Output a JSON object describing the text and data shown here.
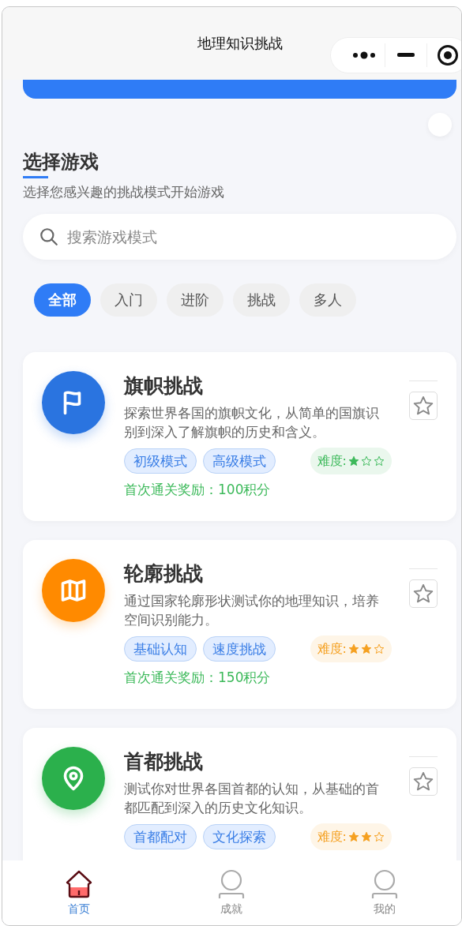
{
  "header": {
    "title": "地理知识挑战"
  },
  "section": {
    "title": "选择游戏",
    "subtitle": "选择您感兴趣的挑战模式开始游戏"
  },
  "search": {
    "placeholder": "搜索游戏模式"
  },
  "filters": [
    {
      "label": "全部",
      "selected": true
    },
    {
      "label": "入门",
      "selected": false
    },
    {
      "label": "进阶",
      "selected": false
    },
    {
      "label": "挑战",
      "selected": false
    },
    {
      "label": "多人",
      "selected": false
    }
  ],
  "games": [
    {
      "title": "旗帜挑战",
      "icon": {
        "kind": "flag",
        "color": "#2a74e0"
      },
      "description": "探索世界各国的旗帜文化，从简单的国旗识别到深入了解旗帜的历史和含义。",
      "tags": [
        "初级模式",
        "高级模式"
      ],
      "difficulty": {
        "label": "难度:",
        "stars": 1,
        "color": "#3cb95a"
      },
      "reward": "首次通关奖励：100积分",
      "favorite": false
    },
    {
      "title": "轮廓挑战",
      "icon": {
        "kind": "map",
        "color": "#ff8a00"
      },
      "description": "通过国家轮廓形状测试你的地理知识，培养空间识别能力。",
      "tags": [
        "基础认知",
        "速度挑战"
      ],
      "difficulty": {
        "label": "难度:",
        "stars": 2,
        "color": "#f5a020"
      },
      "reward": "首次通关奖励：150积分",
      "favorite": false
    },
    {
      "title": "首都挑战",
      "icon": {
        "kind": "pin",
        "color": "#2bb04c"
      },
      "description": "测试你对世界各国首都的认知，从基础的首都匹配到深入的历史文化知识。",
      "tags": [
        "首都配对",
        "文化探索"
      ],
      "difficulty": {
        "label": "难度:",
        "stars": 2,
        "color": "#f5a020"
      },
      "favorite": false
    }
  ],
  "tabbar": [
    {
      "label": "首页",
      "kind": "home",
      "selected": true
    },
    {
      "label": "成就",
      "kind": "person",
      "selected": false
    },
    {
      "label": "我的",
      "kind": "person",
      "selected": false
    }
  ]
}
